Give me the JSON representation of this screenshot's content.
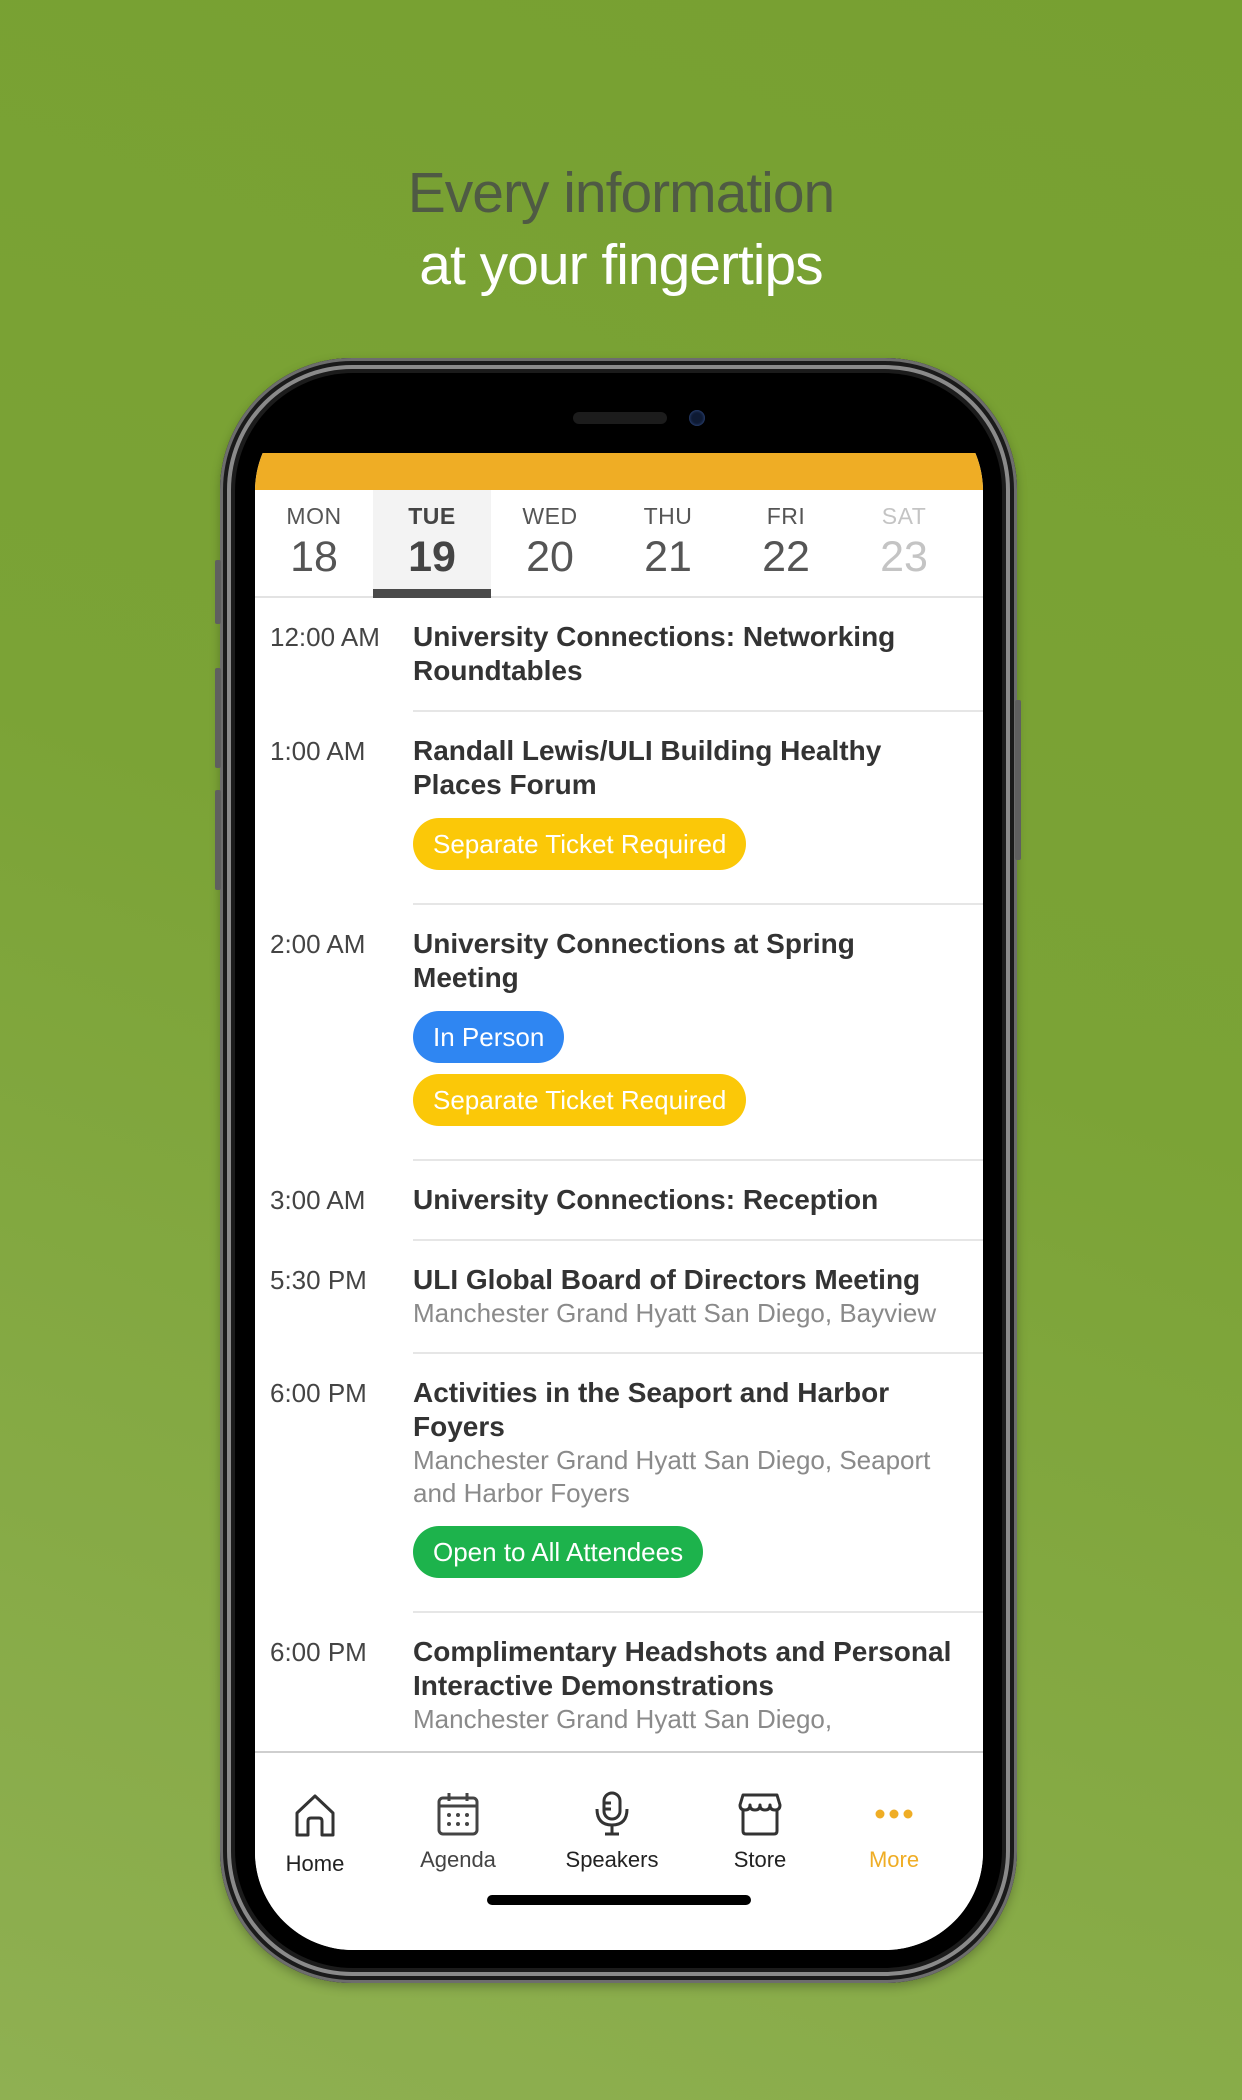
{
  "headline": {
    "line1": "Every information",
    "line2": "at your fingertips"
  },
  "colors": {
    "accent": "#efad25",
    "badge_yellow": "#fbc808",
    "badge_blue": "#2f86f2",
    "badge_green": "#1db34c"
  },
  "days": [
    {
      "dow": "MON",
      "num": "18",
      "state": "normal"
    },
    {
      "dow": "TUE",
      "num": "19",
      "state": "selected"
    },
    {
      "dow": "WED",
      "num": "20",
      "state": "normal"
    },
    {
      "dow": "THU",
      "num": "21",
      "state": "normal"
    },
    {
      "dow": "FRI",
      "num": "22",
      "state": "normal"
    },
    {
      "dow": "SAT",
      "num": "23",
      "state": "disabled"
    }
  ],
  "events": [
    {
      "time": "12:00 AM",
      "title": "University Connections: Networking Roundtables",
      "location": "",
      "badges": []
    },
    {
      "time": "1:00 AM",
      "title": "Randall Lewis/ULI Building Healthy Places Forum",
      "location": "",
      "badges": [
        {
          "label": "Separate Ticket Required",
          "color": "yellow"
        }
      ]
    },
    {
      "time": "2:00 AM",
      "title": "University Connections at Spring Meeting",
      "location": "",
      "badges": [
        {
          "label": "In Person",
          "color": "blue"
        },
        {
          "label": "Separate Ticket Required",
          "color": "yellow"
        }
      ]
    },
    {
      "time": "3:00 AM",
      "title": "University Connections: Reception",
      "location": "",
      "badges": []
    },
    {
      "time": "5:30 PM",
      "title": "ULI Global Board of Directors Meeting",
      "location": "Manchester Grand Hyatt San Diego, Bayview",
      "badges": []
    },
    {
      "time": "6:00 PM",
      "title": "Activities in the Seaport and Harbor Foyers",
      "location": "Manchester Grand Hyatt San Diego, Seaport and Harbor Foyers",
      "badges": [
        {
          "label": "Open to All Attendees",
          "color": "green"
        }
      ]
    },
    {
      "time": "6:00 PM",
      "title": "Complimentary Headshots and Personal Interactive Demonstrations",
      "location": "Manchester Grand Hyatt San Diego,",
      "badges": []
    }
  ],
  "tabbar": {
    "items": [
      {
        "label": "Home",
        "icon": "home-icon",
        "active": false
      },
      {
        "label": "Agenda",
        "icon": "calendar-icon",
        "active": false
      },
      {
        "label": "Speakers",
        "icon": "microphone-icon",
        "active": false
      },
      {
        "label": "Store",
        "icon": "store-icon",
        "active": false
      },
      {
        "label": "More",
        "icon": "more-dots-icon",
        "active": true
      }
    ]
  }
}
